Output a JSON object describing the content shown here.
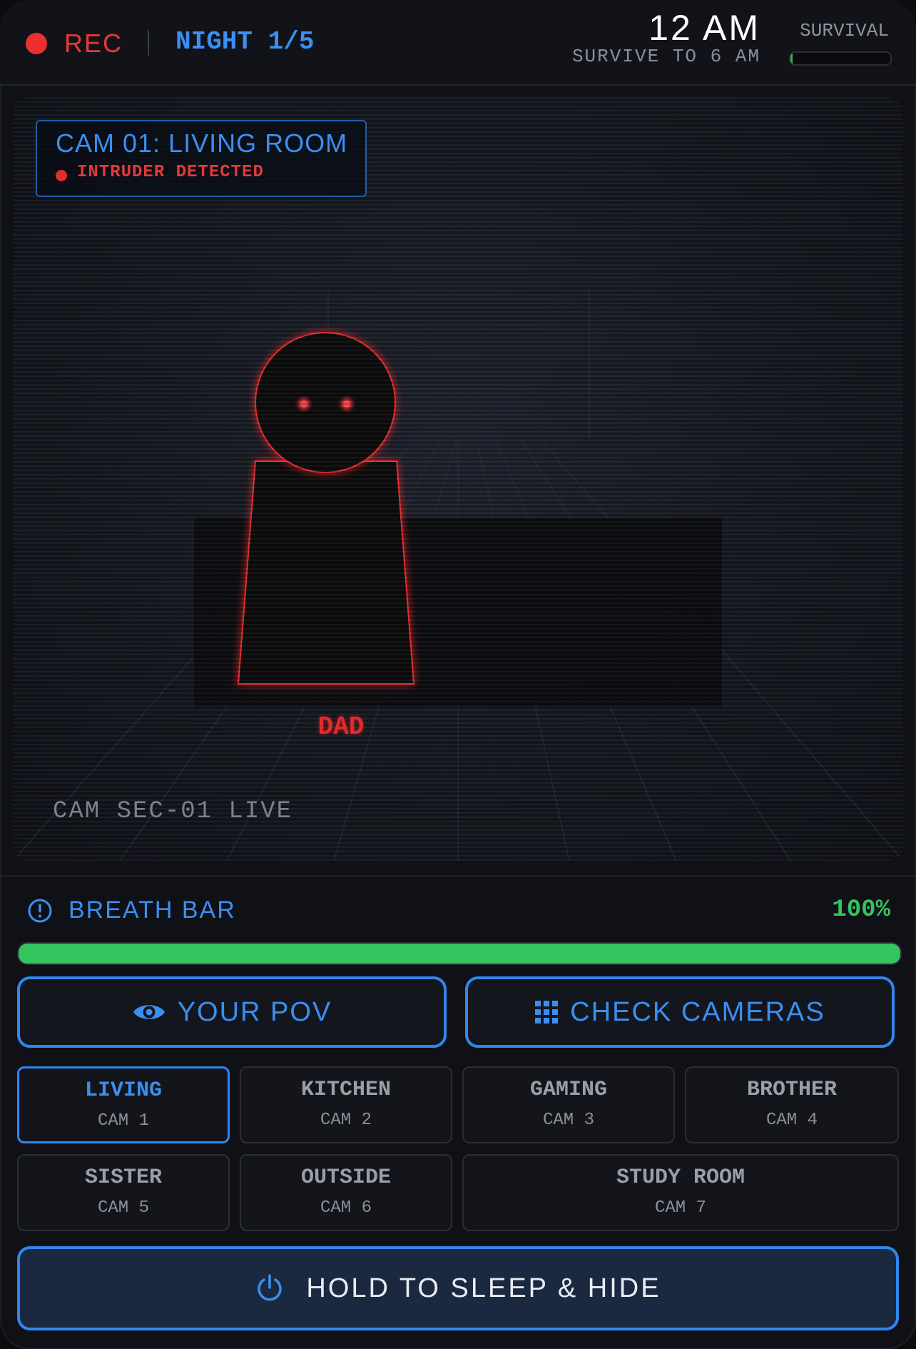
{
  "header": {
    "rec_label": "REC",
    "night_label": "NIGHT 1/5",
    "clock": "12 AM",
    "goal": "SURVIVE TO 6 AM",
    "survival_label": "SURVIVAL",
    "survival_progress": 0.02
  },
  "feed": {
    "camera_title": "CAM 01: LIVING ROOM",
    "alert": "INTRUDER DETECTED",
    "figure_name": "DAD",
    "live_label": "CAM SEC-01 LIVE"
  },
  "breath": {
    "label": "BREATH BAR",
    "value_text": "100%",
    "value": 1.0
  },
  "buttons": {
    "pov": "YOUR POV",
    "cameras": "CHECK CAMERAS",
    "sleep": "HOLD TO SLEEP & HIDE"
  },
  "cameras": [
    {
      "room": "LIVING",
      "cam": "CAM 1",
      "active": true
    },
    {
      "room": "KITCHEN",
      "cam": "CAM 2",
      "active": false
    },
    {
      "room": "GAMING",
      "cam": "CAM 3",
      "active": false
    },
    {
      "room": "BROTHER",
      "cam": "CAM 4",
      "active": false
    },
    {
      "room": "SISTER",
      "cam": "CAM 5",
      "active": false
    },
    {
      "room": "OUTSIDE",
      "cam": "CAM 6",
      "active": false
    },
    {
      "room": "STUDY ROOM",
      "cam": "CAM 7",
      "active": false
    }
  ],
  "colors": {
    "accent": "#3a8ff0",
    "danger": "#e23a3a",
    "success": "#34c55e"
  },
  "icons": {
    "rec": "rec-dot",
    "breath": "alert-circle-icon",
    "pov": "eye-icon",
    "cameras": "grid-icon",
    "sleep": "power-icon"
  }
}
